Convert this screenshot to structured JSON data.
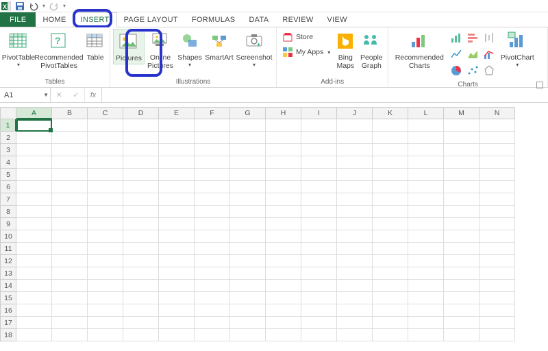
{
  "qat": {
    "tooltip_save": "Save",
    "tooltip_undo": "Undo",
    "tooltip_redo": "Redo"
  },
  "tabs": {
    "file": "FILE",
    "home": "HOME",
    "insert": "INSERT",
    "pagelayout": "PAGE LAYOUT",
    "formulas": "FORMULAS",
    "data": "DATA",
    "review": "REVIEW",
    "view": "VIEW"
  },
  "ribbon": {
    "tables": {
      "label": "Tables",
      "pivottable": "PivotTable",
      "recommended": "Recommended\nPivotTables",
      "table": "Table"
    },
    "illustrations": {
      "label": "Illustrations",
      "pictures": "Pictures",
      "online": "Online\nPictures",
      "shapes": "Shapes",
      "smartart": "SmartArt",
      "screenshot": "Screenshot"
    },
    "addins": {
      "label": "Add-ins",
      "store": "Store",
      "myapps": "My Apps",
      "bing": "Bing\nMaps",
      "people": "People\nGraph"
    },
    "charts": {
      "label": "Charts",
      "recommended": "Recommended\nCharts",
      "pivotchart": "PivotChart"
    }
  },
  "fx": {
    "namebox": "A1",
    "fx_label": "fx"
  },
  "grid": {
    "cols": [
      "A",
      "B",
      "C",
      "D",
      "E",
      "F",
      "G",
      "H",
      "I",
      "J",
      "K",
      "L",
      "M",
      "N"
    ],
    "rows": [
      "1",
      "2",
      "3",
      "4",
      "5",
      "6",
      "7",
      "8",
      "9",
      "10",
      "11",
      "12",
      "13",
      "14",
      "15",
      "16",
      "17",
      "18"
    ],
    "active": "A1"
  },
  "colors": {
    "excel_green": "#217346",
    "highlight_blue": "#2733cc"
  }
}
